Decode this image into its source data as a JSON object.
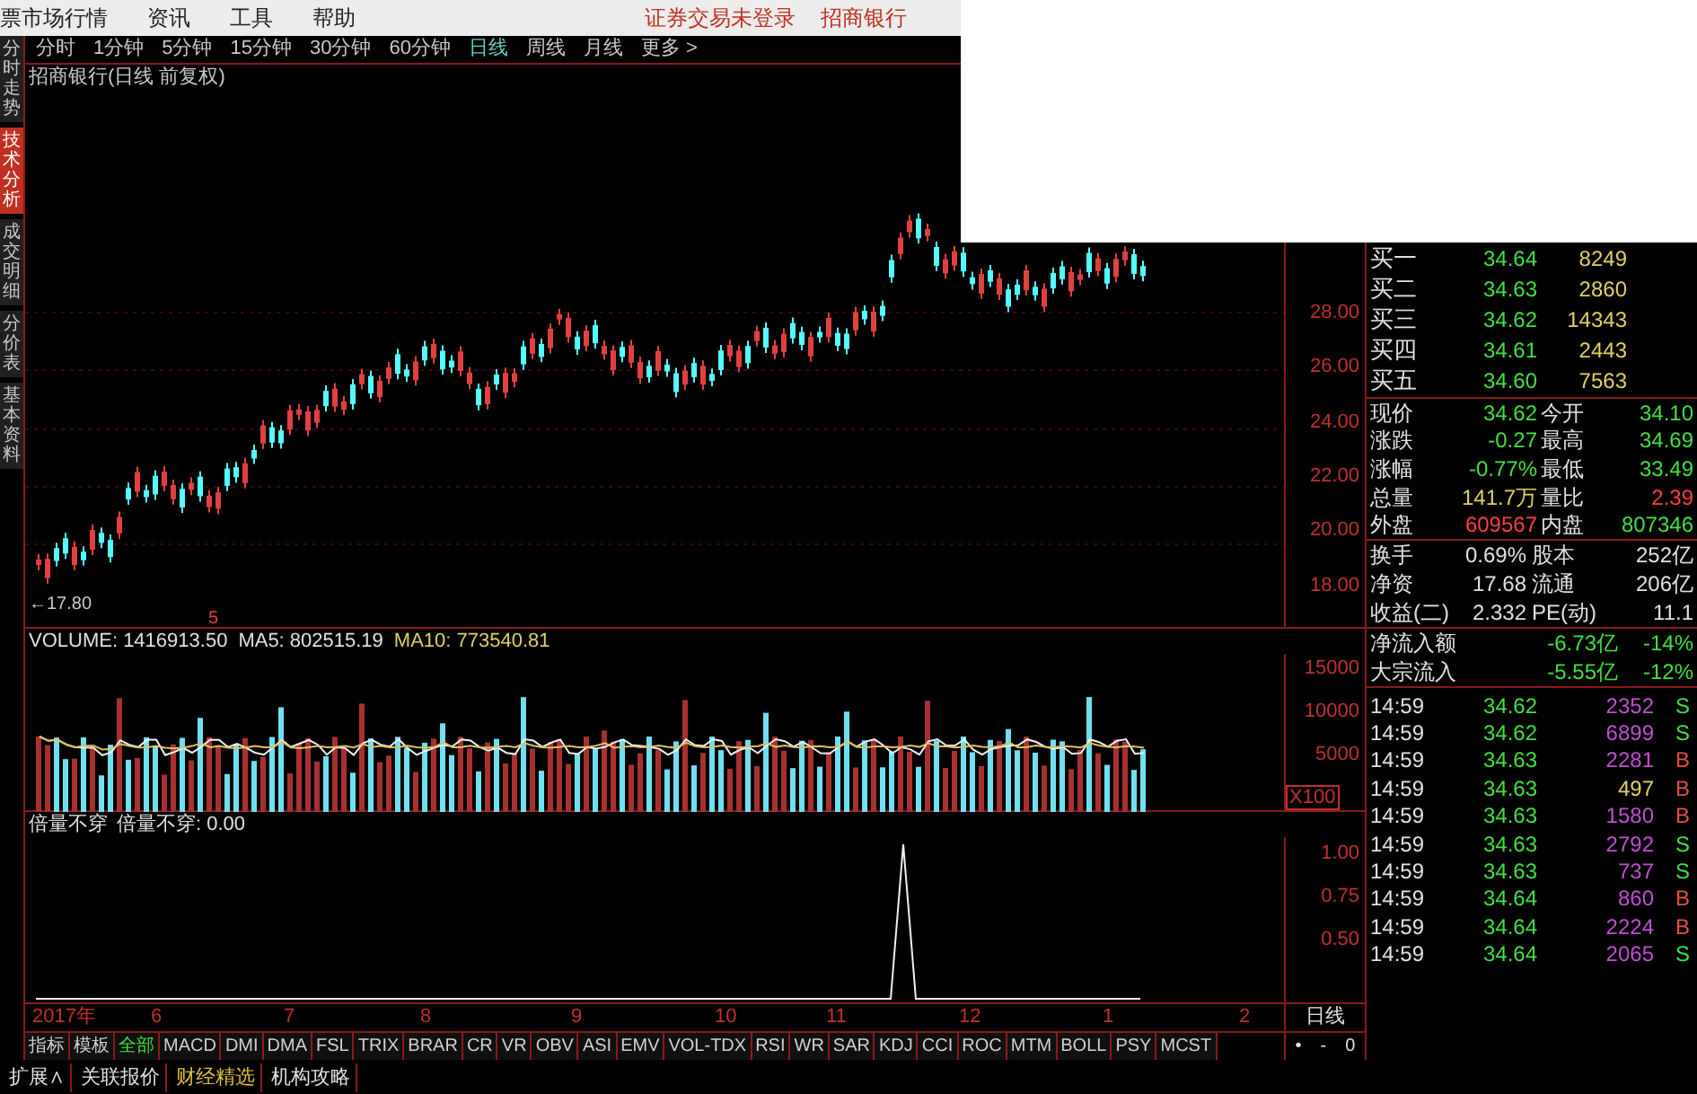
{
  "menu_bar": {
    "items": [
      "票市场行情",
      "资讯",
      "工具",
      "帮助"
    ],
    "status": [
      "证券交易未登录",
      "招商银行"
    ]
  },
  "side_tabs": [
    {
      "label": "分时走势",
      "selected": false
    },
    {
      "label": "技术分析",
      "selected": true
    },
    {
      "label": "成交明细",
      "selected": false
    },
    {
      "label": "分价表",
      "selected": false
    },
    {
      "label": "基本资料",
      "selected": false
    }
  ],
  "period_tabs": [
    {
      "label": "分时",
      "selected": false
    },
    {
      "label": "1分钟",
      "selected": false
    },
    {
      "label": "5分钟",
      "selected": false
    },
    {
      "label": "15分钟",
      "selected": false
    },
    {
      "label": "30分钟",
      "selected": false
    },
    {
      "label": "60分钟",
      "selected": false
    },
    {
      "label": "日线",
      "selected": true
    },
    {
      "label": "周线",
      "selected": false
    },
    {
      "label": "月线",
      "selected": false
    },
    {
      "label": "更多 >",
      "selected": false
    }
  ],
  "chart_title": "招商银行(日线 前复权)",
  "price_pane": {
    "low_label": "←17.80",
    "marker": "5",
    "axis": [
      "28.00",
      "26.00",
      "24.00",
      "22.00",
      "20.00",
      "18.00"
    ]
  },
  "volume_pane": {
    "volume": "VOLUME: 1416913.50",
    "ma5": "MA5: 802515.19",
    "ma10": "MA10: 773540.81",
    "axis": [
      "15000",
      "10000",
      "5000"
    ],
    "unit": "X100"
  },
  "indicator_pane": {
    "name": "倍量不穿",
    "value": "倍量不穿: 0.00",
    "axis": [
      "1.00",
      "0.75",
      "0.50"
    ]
  },
  "date_axis": {
    "labels": [
      "2017年",
      "6",
      "7",
      "8",
      "9",
      "10",
      "11",
      "12",
      "1",
      "2"
    ],
    "period": "日线"
  },
  "indicator_tabs": [
    {
      "label": "指标",
      "selected": false
    },
    {
      "label": "模板",
      "selected": false
    },
    {
      "label": "全部",
      "selected": true
    },
    {
      "label": "MACD",
      "selected": false
    },
    {
      "label": "DMI",
      "selected": false
    },
    {
      "label": "DMA",
      "selected": false
    },
    {
      "label": "FSL",
      "selected": false
    },
    {
      "label": "TRIX",
      "selected": false
    },
    {
      "label": "BRAR",
      "selected": false
    },
    {
      "label": "CR",
      "selected": false
    },
    {
      "label": "VR",
      "selected": false
    },
    {
      "label": "OBV",
      "selected": false
    },
    {
      "label": "ASI",
      "selected": false
    },
    {
      "label": "EMV",
      "selected": false
    },
    {
      "label": "VOL-TDX",
      "selected": false
    },
    {
      "label": "RSI",
      "selected": false
    },
    {
      "label": "WR",
      "selected": false
    },
    {
      "label": "SAR",
      "selected": false
    },
    {
      "label": "KDJ",
      "selected": false
    },
    {
      "label": "CCI",
      "selected": false
    },
    {
      "label": "ROC",
      "selected": false
    },
    {
      "label": "MTM",
      "selected": false
    },
    {
      "label": "BOLL",
      "selected": false
    },
    {
      "label": "PSY",
      "selected": false
    },
    {
      "label": "MCST",
      "selected": false
    }
  ],
  "zoom_buttons": [
    "•",
    "-",
    "0"
  ],
  "bottom_tabs": [
    {
      "label": "扩展∧",
      "color": "#e0e0e0"
    },
    {
      "label": "关联报价",
      "color": "#e0e0e0"
    },
    {
      "label": "财经精选",
      "color": "#e0c040"
    },
    {
      "label": "机构攻略",
      "color": "#e0e0e0"
    }
  ],
  "bids": [
    {
      "label": "买一",
      "price": "34.64",
      "volume": "8249"
    },
    {
      "label": "买二",
      "price": "34.63",
      "volume": "2860"
    },
    {
      "label": "买三",
      "price": "34.62",
      "volume": "14343"
    },
    {
      "label": "买四",
      "price": "34.61",
      "volume": "2443"
    },
    {
      "label": "买五",
      "price": "34.60",
      "volume": "7563"
    }
  ],
  "quote": [
    {
      "cells": [
        {
          "label": "现价",
          "value": "34.62",
          "color": "#40e040"
        },
        {
          "label": "今开",
          "value": "34.10",
          "color": "#40e040"
        }
      ]
    },
    {
      "cells": [
        {
          "label": "涨跌",
          "value": "-0.27",
          "color": "#40e040"
        },
        {
          "label": "最高",
          "value": "34.69",
          "color": "#40e040"
        }
      ]
    },
    {
      "cells": [
        {
          "label": "涨幅",
          "value": "-0.77%",
          "color": "#40e040"
        },
        {
          "label": "最低",
          "value": "33.49",
          "color": "#40e040"
        }
      ]
    },
    {
      "cells": [
        {
          "label": "总量",
          "value": "141.7万",
          "color": "#e0d060"
        },
        {
          "label": "量比",
          "value": "2.39",
          "color": "#ff4040"
        }
      ]
    },
    {
      "cells": [
        {
          "label": "外盘",
          "value": "609567",
          "color": "#ff4040"
        },
        {
          "label": "内盘",
          "value": "807346",
          "color": "#40e040"
        }
      ]
    }
  ],
  "stats": [
    {
      "label": "换手",
      "value": "0.69%",
      "label2": "股本",
      "value2": "252亿"
    },
    {
      "label": "净资",
      "value": "17.68",
      "label2": "流通",
      "value2": "206亿"
    },
    {
      "label": "收益(二)",
      "value": "2.332",
      "label2": "PE(动)",
      "value2": "11.1"
    }
  ],
  "flows": [
    {
      "label": "净流入额",
      "amount": "-6.73亿",
      "percent": "-14%"
    },
    {
      "label": "大宗流入",
      "amount": "-5.55亿",
      "percent": "-12%"
    }
  ],
  "ticks": [
    {
      "time": "14:59",
      "price": "34.62",
      "volume": {
        "label": "2352",
        "color": "#c050d0"
      },
      "side": {
        "label": "S",
        "color": "#40e040"
      }
    },
    {
      "time": "14:59",
      "price": "34.62",
      "volume": {
        "label": "6899",
        "color": "#c050d0"
      },
      "side": {
        "label": "S",
        "color": "#40e040"
      }
    },
    {
      "time": "14:59",
      "price": "34.63",
      "volume": {
        "label": "2281",
        "color": "#c050d0"
      },
      "side": {
        "label": "B",
        "color": "#e05040"
      }
    },
    {
      "time": "14:59",
      "price": "34.63",
      "volume": {
        "label": "497",
        "color": "#e0d060"
      },
      "side": {
        "label": "B",
        "color": "#e05040"
      }
    },
    {
      "time": "14:59",
      "price": "34.63",
      "volume": {
        "label": "1580",
        "color": "#c050d0"
      },
      "side": {
        "label": "B",
        "color": "#e05040"
      }
    },
    {
      "time": "14:59",
      "price": "34.63",
      "volume": {
        "label": "2792",
        "color": "#c050d0"
      },
      "side": {
        "label": "S",
        "color": "#40e040"
      }
    },
    {
      "time": "14:59",
      "price": "34.63",
      "volume": {
        "label": "737",
        "color": "#c050d0"
      },
      "side": {
        "label": "S",
        "color": "#40e040"
      }
    },
    {
      "time": "14:59",
      "price": "34.64",
      "volume": {
        "label": "860",
        "color": "#c050d0"
      },
      "side": {
        "label": "B",
        "color": "#e05040"
      }
    },
    {
      "time": "14:59",
      "price": "34.64",
      "volume": {
        "label": "2224",
        "color": "#c050d0"
      },
      "side": {
        "label": "B",
        "color": "#e05040"
      }
    },
    {
      "time": "14:59",
      "price": "34.64",
      "volume": {
        "label": "2065",
        "color": "#c050d0"
      },
      "side": {
        "label": "S",
        "color": "#40e040"
      }
    }
  ]
}
